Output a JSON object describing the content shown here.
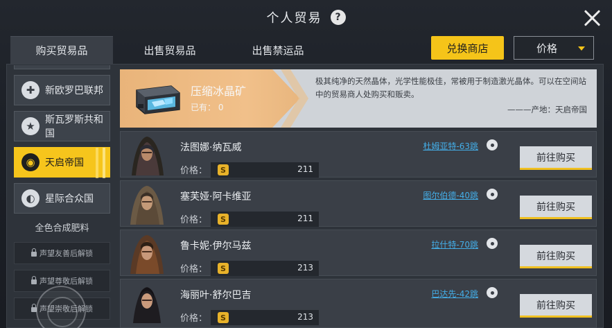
{
  "title": "个人贸易",
  "help_label": "?",
  "tabs": [
    {
      "label": "购买贸易品",
      "active": true
    },
    {
      "label": "出售贸易品",
      "active": false
    },
    {
      "label": "出售禁运品",
      "active": false
    }
  ],
  "shop_button": "兑换商店",
  "sort_dropdown": {
    "selected": "价格"
  },
  "sidebar": {
    "factions": [
      {
        "label": "新欧罗巴联邦",
        "icon": "cross-emblem-icon",
        "glyph": "✚",
        "active": false
      },
      {
        "label": "斯瓦罗斯共和国",
        "icon": "star-emblem-icon",
        "glyph": "★",
        "active": false
      },
      {
        "label": "天启帝国",
        "icon": "apocalypse-emblem-icon",
        "glyph": "◉",
        "active": true
      },
      {
        "label": "星际合众国",
        "icon": "union-emblem-icon",
        "glyph": "◐",
        "active": false
      }
    ],
    "section_label": "全色合成肥料",
    "locked_items": [
      "声望友善后解锁",
      "声望尊敬后解锁",
      "声望崇敬后解锁"
    ]
  },
  "item": {
    "name": "压缩冰晶矿",
    "owned": "已有：  0",
    "description": "极其纯净的天然晶体，光学性能极佳，常被用于制造激光晶体。可以在空间站中的贸易商人处购买和贩卖。",
    "origin": "———产地：天启帝国"
  },
  "price_label": "价格：",
  "currency_symbol": "S",
  "merchants": [
    {
      "name": "法图娜·纳瓦威",
      "location": "杜姆亚特-63跳",
      "price": "211",
      "buy_label": "前往购买"
    },
    {
      "name": "塞芙娅·阿卡维亚",
      "location": "图尔伯德-40跳",
      "price": "211",
      "buy_label": "前往购买"
    },
    {
      "name": "鲁卡妮·伊尔马兹",
      "location": "拉什特-70跳",
      "price": "213",
      "buy_label": "前往购买"
    },
    {
      "name": "海丽叶·舒尔巴吉",
      "location": "巴达先-42跳",
      "price": "213",
      "buy_label": "前往购买"
    }
  ]
}
